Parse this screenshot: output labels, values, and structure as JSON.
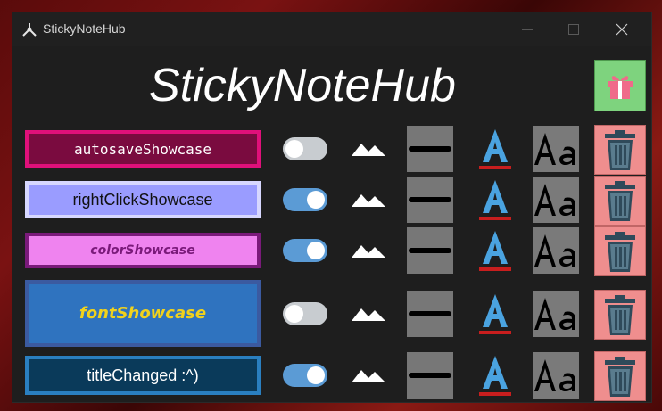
{
  "window": {
    "title": "StickyNoteHub"
  },
  "header": {
    "title": "StickyNoteHub"
  },
  "notes": [
    {
      "title": "autosaveShowcase",
      "toggle_on": false,
      "bg": "#7a0b3f",
      "border": "#e0107a",
      "text_color": "#ffffff"
    },
    {
      "title": "rightClickShowcase",
      "toggle_on": true,
      "bg": "#9a9cff",
      "border": "#d7d7ff",
      "text_color": "#111111"
    },
    {
      "title": "colorShowcase",
      "toggle_on": true,
      "bg": "#ef83ef",
      "border": "#7a1a7a",
      "text_color": "#7a1a7a"
    },
    {
      "title": "fontShowcase",
      "toggle_on": false,
      "bg": "#2f73bf",
      "border": "#3b5aa0",
      "text_color": "#f1d21c"
    },
    {
      "title": "titleChanged :^)",
      "toggle_on": true,
      "bg": "#0a3a5a",
      "border": "#2a7fc0",
      "text_color": "#ffffff"
    }
  ],
  "icons": {
    "app": "app-icon",
    "gift": "gift-icon",
    "opacity": "mountain-icon",
    "strike": "strikethrough-icon",
    "font_color": "font-color-icon",
    "font_size": "font-size-icon",
    "delete": "trash-icon"
  },
  "colors": {
    "accent_blue": "#4aa3e0",
    "gift_bg": "#7ed37e",
    "delete_bg": "#ef8e8e"
  }
}
